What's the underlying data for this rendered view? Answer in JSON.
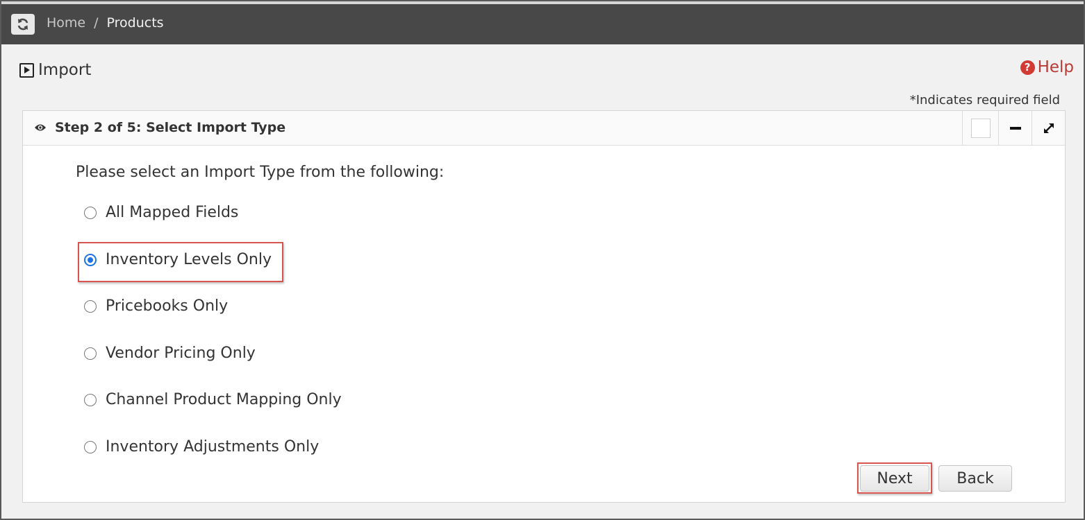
{
  "breadcrumb": {
    "home": "Home",
    "separator": "/",
    "current": "Products"
  },
  "page": {
    "title": "Import",
    "help_label": "Help",
    "required_note": "*Indicates required field"
  },
  "panel": {
    "title": "Step 2 of 5: Select Import Type",
    "intro": "Please select an Import Type from the following:",
    "options": [
      {
        "label": "All Mapped Fields",
        "checked": false
      },
      {
        "label": "Inventory Levels Only",
        "checked": true
      },
      {
        "label": "Pricebooks Only",
        "checked": false
      },
      {
        "label": "Vendor Pricing Only",
        "checked": false
      },
      {
        "label": "Channel Product Mapping Only",
        "checked": false
      },
      {
        "label": "Inventory Adjustments Only",
        "checked": false
      }
    ],
    "buttons": {
      "next": "Next",
      "back": "Back"
    }
  },
  "colors": {
    "topbar": "#484848",
    "help": "#b83a34",
    "highlight": "#d9534f",
    "radio_checked": "#1a73e8"
  }
}
